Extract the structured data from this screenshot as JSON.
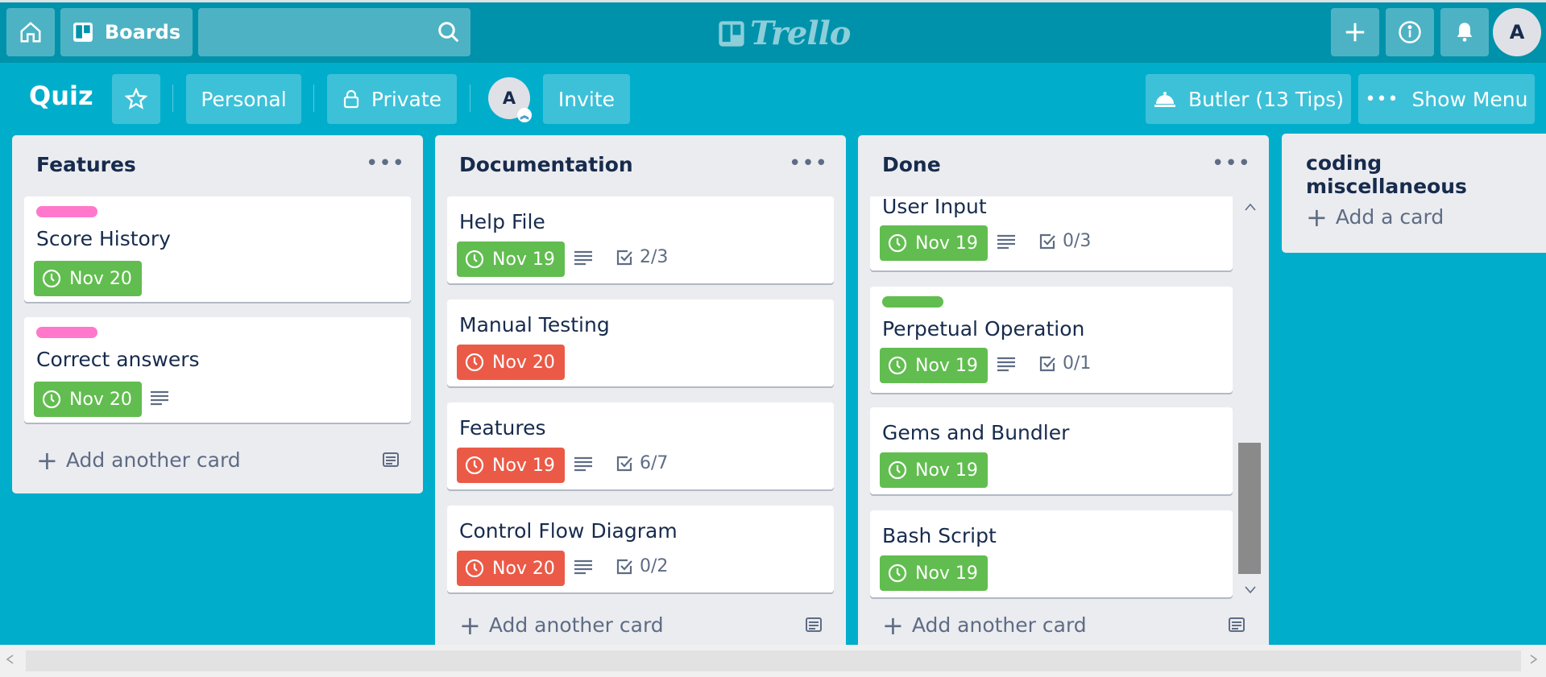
{
  "topbar": {
    "boards_label": "Boards",
    "logo_text": "Trello",
    "avatar_initial": "A"
  },
  "board": {
    "title": "Quiz",
    "team_label": "Personal",
    "visibility_label": "Private",
    "member_initial": "A",
    "invite_label": "Invite",
    "butler_label": "Butler (13 Tips)",
    "menu_label": "Show Menu"
  },
  "lists": [
    {
      "title": "Features",
      "cards": [
        {
          "title": "Score History",
          "label_color": "#ff78cb",
          "due": "Nov 20",
          "due_color": "#61bd4f",
          "has_description": false,
          "checklist": ""
        },
        {
          "title": "Correct answers",
          "label_color": "#ff78cb",
          "due": "Nov 20",
          "due_color": "#61bd4f",
          "has_description": true,
          "checklist": ""
        }
      ],
      "add_label": "Add another card"
    },
    {
      "title": "Documentation",
      "cards": [
        {
          "title": "Help File",
          "due": "Nov 19",
          "due_color": "#61bd4f",
          "has_description": true,
          "checklist": "2/3"
        },
        {
          "title": "Manual Testing",
          "due": "Nov 20",
          "due_color": "#eb5a46",
          "has_description": false,
          "checklist": ""
        },
        {
          "title": "Features",
          "due": "Nov 19",
          "due_color": "#eb5a46",
          "has_description": true,
          "checklist": "6/7"
        },
        {
          "title": "Control Flow Diagram",
          "due": "Nov 20",
          "due_color": "#eb5a46",
          "has_description": true,
          "checklist": "0/2"
        }
      ],
      "add_label": "Add another card"
    },
    {
      "title": "Done",
      "cards": [
        {
          "title": "User Input",
          "due": "Nov 19",
          "due_color": "#61bd4f",
          "has_description": true,
          "checklist": "0/3"
        },
        {
          "title": "Perpetual Operation",
          "label_color": "#61bd4f",
          "due": "Nov 19",
          "due_color": "#61bd4f",
          "has_description": true,
          "checklist": "0/1"
        },
        {
          "title": "Gems and Bundler",
          "due": "Nov 19",
          "due_color": "#61bd4f",
          "has_description": false,
          "checklist": ""
        },
        {
          "title": "Bash Script",
          "due": "Nov 19",
          "due_color": "#61bd4f",
          "has_description": false,
          "checklist": ""
        }
      ],
      "add_label": "Add another card"
    },
    {
      "title": "coding miscellaneous",
      "cards": [],
      "add_label": "Add a card"
    }
  ],
  "colors": {
    "board_background": "#00aecc",
    "nav_background": "#0092ab",
    "green": "#61bd4f",
    "red": "#eb5a46",
    "pink": "#ff78cb"
  }
}
